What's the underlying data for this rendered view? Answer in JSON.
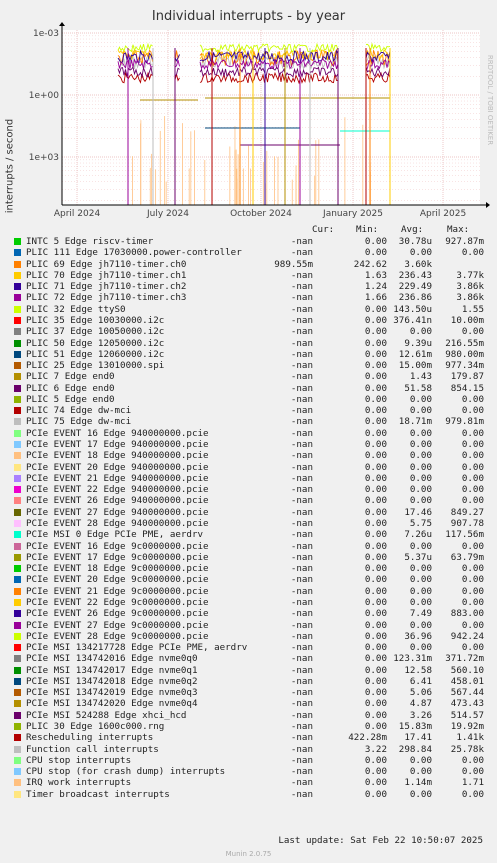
{
  "title": "Individual interrupts - by year",
  "ylabel": "interrupts / second",
  "side_label": "RRDTOOL / TOBI OETIKER",
  "headers": {
    "cur": "Cur:",
    "min": "Min:",
    "avg": "Avg:",
    "max": "Max:"
  },
  "last_update": "Last update: Sat Feb 22 10:50:07 2025",
  "footer": "Munin 2.0.75",
  "chart_data": {
    "type": "line",
    "title": "Individual interrupts - by year",
    "ylabel": "interrupts / second",
    "y_scale": "log",
    "yticks": [
      "1e-03",
      "1e+00",
      "1e+03"
    ],
    "xticks": [
      "April 2024",
      "July 2024",
      "October 2024",
      "January 2025",
      "April 2025"
    ],
    "grid": true,
    "series": [
      {
        "name": "INTC 5 Edge riscv-timer",
        "color": "#00cc00",
        "cur": "-nan",
        "min": "0.00",
        "avg": "30.78u",
        "max": "927.87m"
      },
      {
        "name": "PLIC 111 Edge 17030000.power-controller",
        "color": "#0066b3",
        "cur": "-nan",
        "min": "0.00",
        "avg": "0.00",
        "max": "0.00"
      },
      {
        "name": "PLIC 69 Edge jh7110-timer.ch0",
        "color": "#ff8000",
        "cur": "989.55m",
        "min": "242.62",
        "avg": "3.60k",
        "max": ""
      },
      {
        "name": "PLIC 70 Edge jh7110-timer.ch1",
        "color": "#ffcc00",
        "cur": "-nan",
        "min": "1.63",
        "avg": "236.43",
        "max": "3.77k"
      },
      {
        "name": "PLIC 71 Edge jh7110-timer.ch2",
        "color": "#330099",
        "cur": "-nan",
        "min": "1.24",
        "avg": "229.49",
        "max": "3.86k"
      },
      {
        "name": "PLIC 72 Edge jh7110-timer.ch3",
        "color": "#990099",
        "cur": "-nan",
        "min": "1.66",
        "avg": "236.86",
        "max": "3.86k"
      },
      {
        "name": "PLIC 32 Edge ttyS0",
        "color": "#ccff00",
        "cur": "-nan",
        "min": "0.00",
        "avg": "143.50u",
        "max": "1.55"
      },
      {
        "name": "PLIC 35 Edge 10030000.i2c",
        "color": "#ff0000",
        "cur": "-nan",
        "min": "0.00",
        "avg": "376.41n",
        "max": "10.00m"
      },
      {
        "name": "PLIC 37 Edge 10050000.i2c",
        "color": "#808080",
        "cur": "-nan",
        "min": "0.00",
        "avg": "0.00",
        "max": "0.00"
      },
      {
        "name": "PLIC 50 Edge 12050000.i2c",
        "color": "#008f00",
        "cur": "-nan",
        "min": "0.00",
        "avg": "9.39u",
        "max": "216.55m"
      },
      {
        "name": "PLIC 51 Edge 12060000.i2c",
        "color": "#00487d",
        "cur": "-nan",
        "min": "0.00",
        "avg": "12.61m",
        "max": "980.00m"
      },
      {
        "name": "PLIC 25 Edge 13010000.spi",
        "color": "#b35a00",
        "cur": "-nan",
        "min": "0.00",
        "avg": "15.00m",
        "max": "977.34m"
      },
      {
        "name": "PLIC 7 Edge end0",
        "color": "#b38f00",
        "cur": "-nan",
        "min": "0.00",
        "avg": "1.43",
        "max": "179.87"
      },
      {
        "name": "PLIC 6 Edge end0",
        "color": "#6b006b",
        "cur": "-nan",
        "min": "0.00",
        "avg": "51.58",
        "max": "854.15"
      },
      {
        "name": "PLIC 5 Edge end0",
        "color": "#8fb300",
        "cur": "-nan",
        "min": "0.00",
        "avg": "0.00",
        "max": "0.00"
      },
      {
        "name": "PLIC 74 Edge dw-mci",
        "color": "#b30000",
        "cur": "-nan",
        "min": "0.00",
        "avg": "0.00",
        "max": "0.00"
      },
      {
        "name": "PLIC 75 Edge dw-mci",
        "color": "#bebebe",
        "cur": "-nan",
        "min": "0.00",
        "avg": "18.71m",
        "max": "979.81m"
      },
      {
        "name": "PCIe EVENT 16 Edge 940000000.pcie",
        "color": "#80ff80",
        "cur": "-nan",
        "min": "0.00",
        "avg": "0.00",
        "max": "0.00"
      },
      {
        "name": "PCIe EVENT 17 Edge 940000000.pcie",
        "color": "#80c9ff",
        "cur": "-nan",
        "min": "0.00",
        "avg": "0.00",
        "max": "0.00"
      },
      {
        "name": "PCIe EVENT 18 Edge 940000000.pcie",
        "color": "#ffc080",
        "cur": "-nan",
        "min": "0.00",
        "avg": "0.00",
        "max": "0.00"
      },
      {
        "name": "PCIe EVENT 20 Edge 940000000.pcie",
        "color": "#ffe680",
        "cur": "-nan",
        "min": "0.00",
        "avg": "0.00",
        "max": "0.00"
      },
      {
        "name": "PCIe EVENT 21 Edge 940000000.pcie",
        "color": "#aa80ff",
        "cur": "-nan",
        "min": "0.00",
        "avg": "0.00",
        "max": "0.00"
      },
      {
        "name": "PCIe EVENT 22 Edge 940000000.pcie",
        "color": "#ee00cc",
        "cur": "-nan",
        "min": "0.00",
        "avg": "0.00",
        "max": "0.00"
      },
      {
        "name": "PCIe EVENT 26 Edge 940000000.pcie",
        "color": "#ff8080",
        "cur": "-nan",
        "min": "0.00",
        "avg": "0.00",
        "max": "0.00"
      },
      {
        "name": "PCIe EVENT 27 Edge 940000000.pcie",
        "color": "#666600",
        "cur": "-nan",
        "min": "0.00",
        "avg": "17.46",
        "max": "849.27"
      },
      {
        "name": "PCIe EVENT 28 Edge 940000000.pcie",
        "color": "#ffbfff",
        "cur": "-nan",
        "min": "0.00",
        "avg": "5.75",
        "max": "907.78"
      },
      {
        "name": "PCIe MSI 0 Edge PCIe PME, aerdrv",
        "color": "#00ffcc",
        "cur": "-nan",
        "min": "0.00",
        "avg": "7.26u",
        "max": "117.56m"
      },
      {
        "name": "PCIe EVENT 16 Edge 9c0000000.pcie",
        "color": "#cc6699",
        "cur": "-nan",
        "min": "0.00",
        "avg": "0.00",
        "max": "0.00"
      },
      {
        "name": "PCIe EVENT 17 Edge 9c0000000.pcie",
        "color": "#999900",
        "cur": "-nan",
        "min": "0.00",
        "avg": "5.37u",
        "max": "63.79m"
      },
      {
        "name": "PCIe EVENT 18 Edge 9c0000000.pcie",
        "color": "#00cc00",
        "cur": "-nan",
        "min": "0.00",
        "avg": "0.00",
        "max": "0.00"
      },
      {
        "name": "PCIe EVENT 20 Edge 9c0000000.pcie",
        "color": "#0066b3",
        "cur": "-nan",
        "min": "0.00",
        "avg": "0.00",
        "max": "0.00"
      },
      {
        "name": "PCIe EVENT 21 Edge 9c0000000.pcie",
        "color": "#ff8000",
        "cur": "-nan",
        "min": "0.00",
        "avg": "0.00",
        "max": "0.00"
      },
      {
        "name": "PCIe EVENT 22 Edge 9c0000000.pcie",
        "color": "#ffcc00",
        "cur": "-nan",
        "min": "0.00",
        "avg": "0.00",
        "max": "0.00"
      },
      {
        "name": "PCIe EVENT 26 Edge 9c0000000.pcie",
        "color": "#330099",
        "cur": "-nan",
        "min": "0.00",
        "avg": "7.49",
        "max": "883.00"
      },
      {
        "name": "PCIe EVENT 27 Edge 9c0000000.pcie",
        "color": "#990099",
        "cur": "-nan",
        "min": "0.00",
        "avg": "0.00",
        "max": "0.00"
      },
      {
        "name": "PCIe EVENT 28 Edge 9c0000000.pcie",
        "color": "#ccff00",
        "cur": "-nan",
        "min": "0.00",
        "avg": "36.96",
        "max": "942.24"
      },
      {
        "name": "PCIe MSI 134217728 Edge PCIe PME, aerdrv",
        "color": "#ff0000",
        "cur": "-nan",
        "min": "0.00",
        "avg": "0.00",
        "max": "0.00"
      },
      {
        "name": "PCIe MSI 134742016 Edge nvme0q0",
        "color": "#808080",
        "cur": "-nan",
        "min": "0.00",
        "avg": "123.31m",
        "max": "371.72m"
      },
      {
        "name": "PCIe MSI 134742017 Edge nvme0q1",
        "color": "#008f00",
        "cur": "-nan",
        "min": "0.00",
        "avg": "12.58",
        "max": "560.10"
      },
      {
        "name": "PCIe MSI 134742018 Edge nvme0q2",
        "color": "#00487d",
        "cur": "-nan",
        "min": "0.00",
        "avg": "6.41",
        "max": "458.01"
      },
      {
        "name": "PCIe MSI 134742019 Edge nvme0q3",
        "color": "#b35a00",
        "cur": "-nan",
        "min": "0.00",
        "avg": "5.06",
        "max": "567.44"
      },
      {
        "name": "PCIe MSI 134742020 Edge nvme0q4",
        "color": "#b38f00",
        "cur": "-nan",
        "min": "0.00",
        "avg": "4.87",
        "max": "473.43"
      },
      {
        "name": "PCIe MSI 524288 Edge xhci_hcd",
        "color": "#6b006b",
        "cur": "-nan",
        "min": "0.00",
        "avg": "3.26",
        "max": "514.57"
      },
      {
        "name": "PLIC 30 Edge 1600c000.rng",
        "color": "#8fb300",
        "cur": "-nan",
        "min": "0.00",
        "avg": "15.83m",
        "max": "19.92m"
      },
      {
        "name": "Rescheduling interrupts",
        "color": "#b30000",
        "cur": "-nan",
        "min": "422.28m",
        "avg": "17.41",
        "max": "1.41k"
      },
      {
        "name": "Function call interrupts",
        "color": "#bebebe",
        "cur": "-nan",
        "min": "3.22",
        "avg": "298.84",
        "max": "25.78k"
      },
      {
        "name": "CPU stop interrupts",
        "color": "#80ff80",
        "cur": "-nan",
        "min": "0.00",
        "avg": "0.00",
        "max": "0.00"
      },
      {
        "name": "CPU stop (for crash dump) interrupts",
        "color": "#80c9ff",
        "cur": "-nan",
        "min": "0.00",
        "avg": "0.00",
        "max": "0.00"
      },
      {
        "name": "IRQ work interrupts",
        "color": "#ffc080",
        "cur": "-nan",
        "min": "0.00",
        "avg": "1.14m",
        "max": "1.71"
      },
      {
        "name": "Timer broadcast interrupts",
        "color": "#ffe680",
        "cur": "-nan",
        "min": "0.00",
        "avg": "0.00",
        "max": "0.00"
      }
    ]
  }
}
